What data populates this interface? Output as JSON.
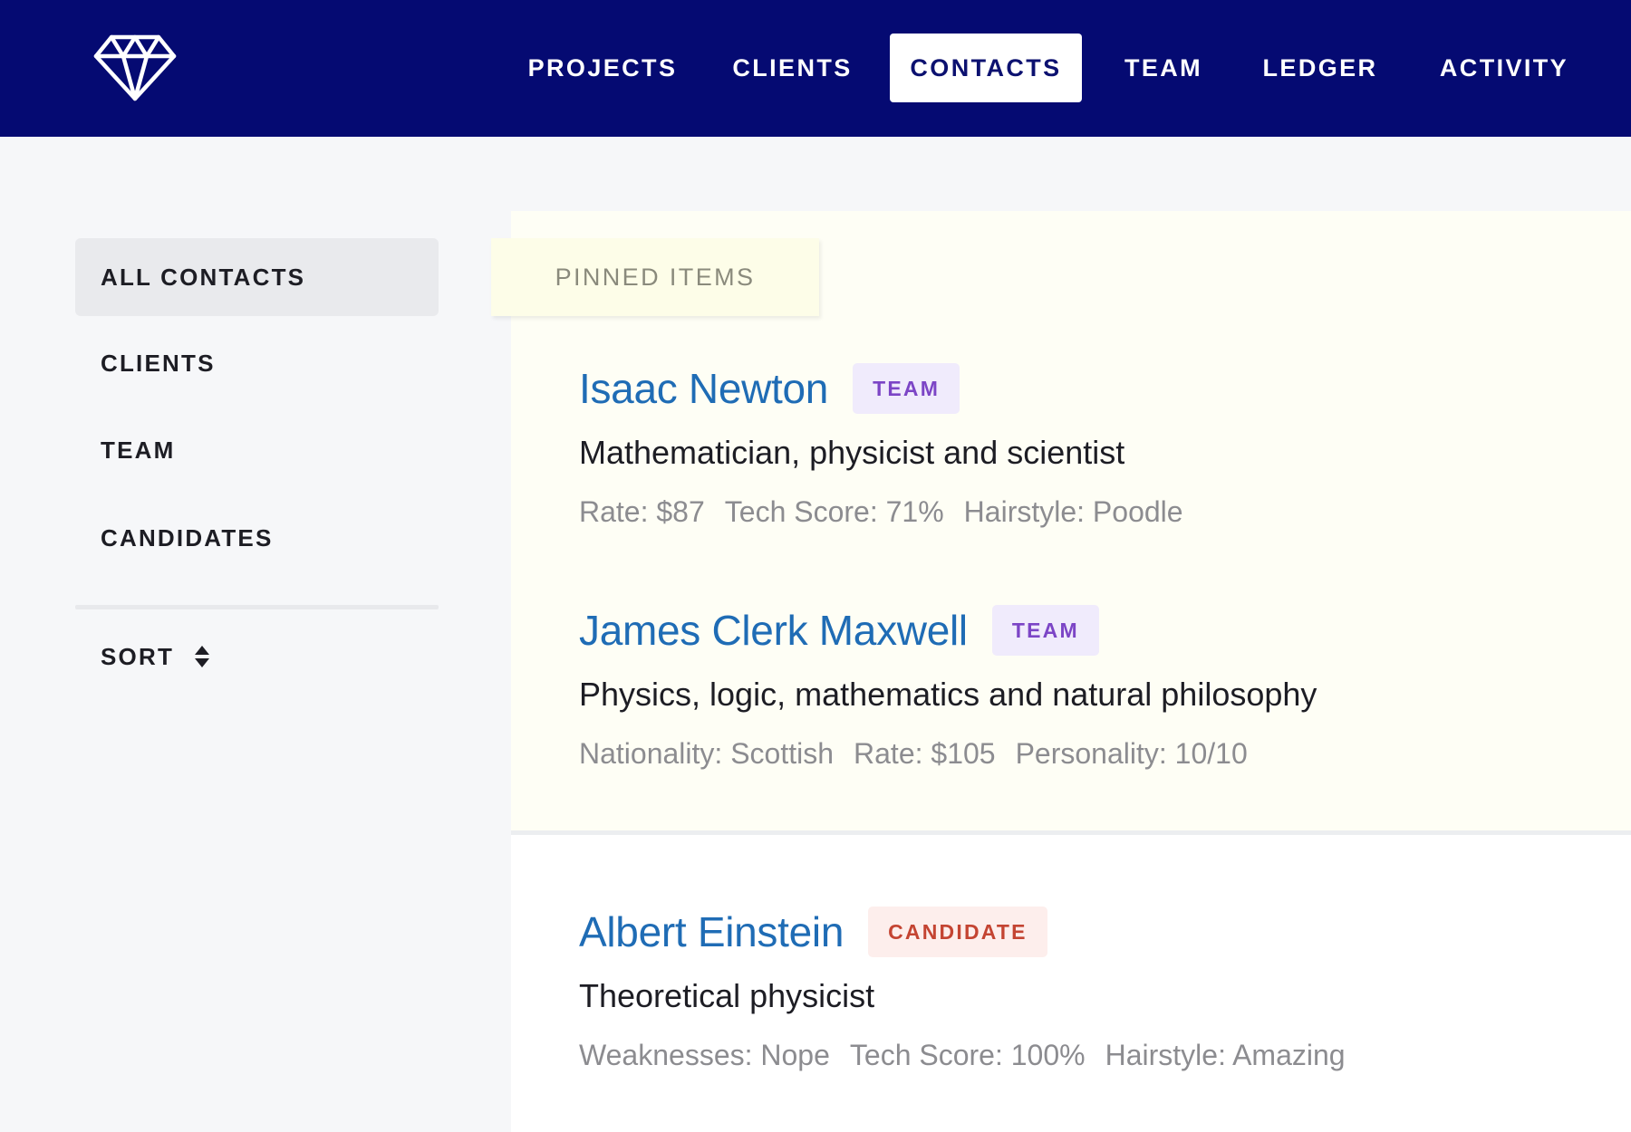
{
  "nav": {
    "items": [
      {
        "label": "PROJECTS",
        "active": false
      },
      {
        "label": "CLIENTS",
        "active": false
      },
      {
        "label": "CONTACTS",
        "active": true
      },
      {
        "label": "TEAM",
        "active": false
      },
      {
        "label": "LEDGER",
        "active": false
      },
      {
        "label": "ACTIVITY",
        "active": false
      }
    ],
    "logo_icon": "diamond-icon"
  },
  "sidebar": {
    "items": [
      {
        "label": "ALL CONTACTS",
        "active": true
      },
      {
        "label": "CLIENTS",
        "active": false
      },
      {
        "label": "TEAM",
        "active": false
      },
      {
        "label": "CANDIDATES",
        "active": false
      }
    ],
    "sort_label": "SORT",
    "sort_icon": "sort-updown-icon"
  },
  "pinned": {
    "tab_label": "PINNED ITEMS",
    "contacts": [
      {
        "name": "Isaac Newton",
        "badge": "TEAM",
        "description": "Mathematician, physicist and scientist",
        "attributes": [
          "Rate: $87",
          "Tech Score: 71%",
          "Hairstyle: Poodle"
        ]
      },
      {
        "name": "James Clerk Maxwell",
        "badge": "TEAM",
        "description": "Physics, logic, mathematics and natural philosophy",
        "attributes": [
          "Nationality: Scottish",
          "Rate: $105",
          "Personality: 10/10"
        ]
      }
    ]
  },
  "contacts": [
    {
      "name": "Albert Einstein",
      "badge": "CANDIDATE",
      "description": "Theoretical physicist",
      "attributes": [
        "Weaknesses: Nope",
        "Tech Score: 100%",
        "Hairstyle: Amazing"
      ]
    }
  ],
  "colors": {
    "nav_bg": "#050a72",
    "link": "#1f6cb5",
    "team_badge": "#7c45c6",
    "candidate_badge": "#c44432",
    "pinned_bg": "#fefef5"
  }
}
